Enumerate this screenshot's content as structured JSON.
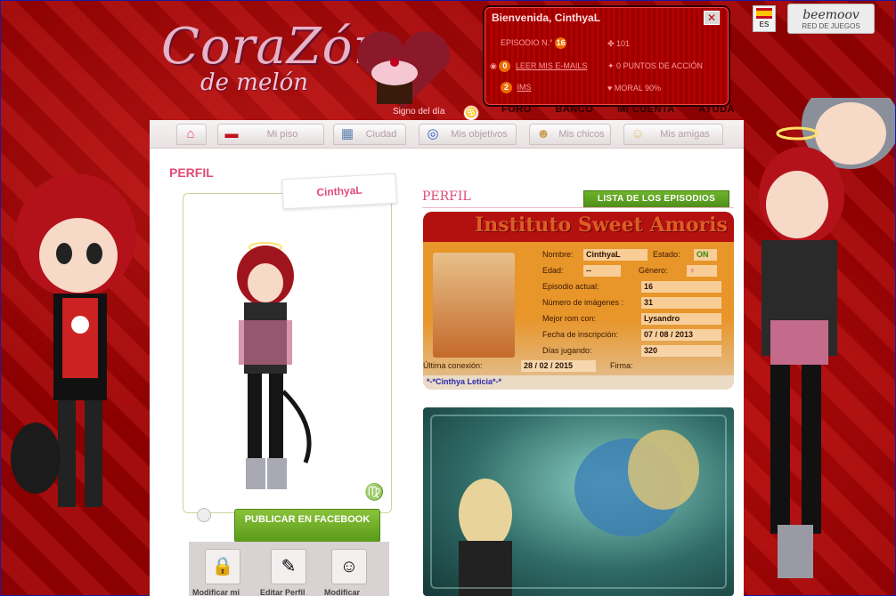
{
  "logo": {
    "line1": "CoraZón",
    "line2": "de melón"
  },
  "sign_of_day": "Signo del día",
  "welcome": {
    "title": "Bienvenida, CinthyaL",
    "episode_label": "EPISODIO N.°",
    "episode_number": "16",
    "stat_ap": "101",
    "messages_count": "0",
    "messages_label": "LEER MIS E-MAILS",
    "action_points": "0 PUNTOS DE ACCIÓN",
    "items_count": "2",
    "items_label": "IMS",
    "moral": "MORAL 90%"
  },
  "top_links": [
    "FORO",
    "BANCO",
    "MI CUENTA",
    "AYUDA"
  ],
  "language": "ES",
  "beemoov": {
    "name": "beemoov",
    "sub": "RED DE JUEGOS"
  },
  "nav": [
    {
      "label": "",
      "icon": "home-icon"
    },
    {
      "label": "Mi piso",
      "icon": "sofa-icon"
    },
    {
      "label": "Ciudad",
      "icon": "city-icon"
    },
    {
      "label": "Mis objetivos",
      "icon": "target-icon"
    },
    {
      "label": "Mis chicos",
      "icon": "boy-icon"
    },
    {
      "label": "Mis amigas",
      "icon": "girl-icon"
    }
  ],
  "page_title": "PERFIL",
  "profile": {
    "username": "CinthyaL",
    "publish_label": "PUBLICAR EN FACEBOOK",
    "actions": [
      "Modificar mi",
      "Editar Perfil",
      "Modificar"
    ]
  },
  "right": {
    "perfil_label": "PERFIL",
    "episodes_button": "LISTA DE LOS EPISODIOS",
    "school_title": "Instituto Sweet Amoris",
    "fields": {
      "name_label": "Nombre:",
      "name_value": "CinthyaL",
      "status_label": "Estado:",
      "status_value": "ON",
      "age_label": "Edad:",
      "age_value": "--",
      "gender_label": "Género:",
      "gender_value": "♀",
      "episode_label": "Episodio actual:",
      "episode_value": "16",
      "images_label": "Número de imágenes :",
      "images_value": "31",
      "best_label": "Mejor rom con:",
      "best_value": "Lysandro",
      "signup_label": "Fecha de inscripción:",
      "signup_value": "07 / 08 / 2013",
      "days_label": "Días jugando:",
      "days_value": "320",
      "last_label": "Última conexión:",
      "last_value": "28 / 02 / 2015",
      "signature_label": "Firma:"
    },
    "signature_text": "*-*Cinthya Leticia*-*"
  },
  "colors": {
    "accent": "#e04a78",
    "green": "#6fb32a",
    "red": "#8b0000"
  }
}
